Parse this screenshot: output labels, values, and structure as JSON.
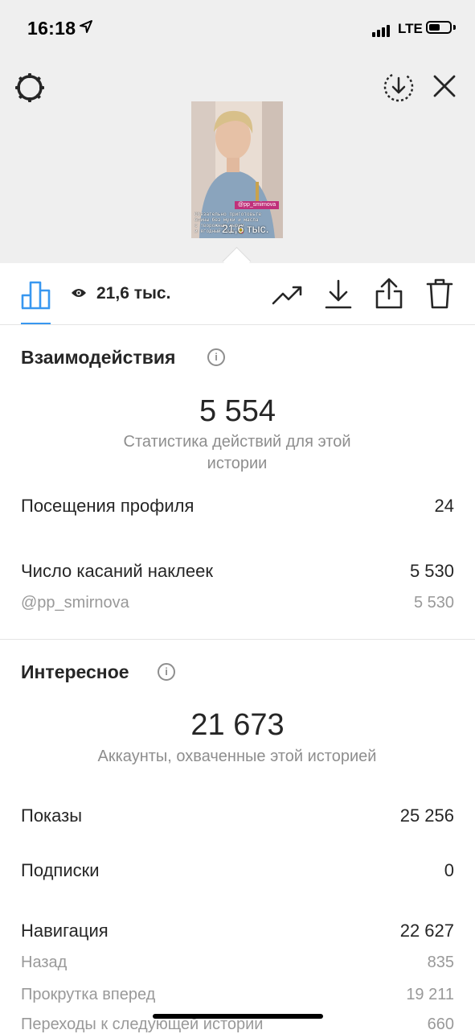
{
  "status_bar": {
    "time": "16:18",
    "network": "LTE"
  },
  "story_preview": {
    "tag": "@pp_smirnova",
    "caption_text": "Обязательно приготовьте\nблины без муки и масла\nс творожным сыром\nи ягодный соус 😋",
    "overlay_views": "21,6 тыс."
  },
  "toolbar": {
    "views": "21,6 тыс."
  },
  "interactions": {
    "title": "Взаимодействия",
    "total": "5 554",
    "caption": "Статистика действий для этой истории",
    "rows": [
      {
        "label": "Посещения профиля",
        "value": "24"
      },
      {
        "label": "Число касаний наклеек",
        "value": "5 530"
      }
    ],
    "sub_rows": [
      {
        "label": "@pp_smirnova",
        "value": "5 530"
      }
    ]
  },
  "discovery": {
    "title": "Интересное",
    "total": "21 673",
    "caption": "Аккаунты, охваченные этой историей",
    "rows": [
      {
        "label": "Показы",
        "value": "25 256"
      },
      {
        "label": "Подписки",
        "value": "0"
      },
      {
        "label": "Навигация",
        "value": "22 627"
      }
    ],
    "sub_rows": [
      {
        "label": "Назад",
        "value": "835"
      },
      {
        "label": "Прокрутка вперед",
        "value": "19 211"
      },
      {
        "label": "Переходы к следующей истории",
        "value": "660"
      }
    ]
  }
}
